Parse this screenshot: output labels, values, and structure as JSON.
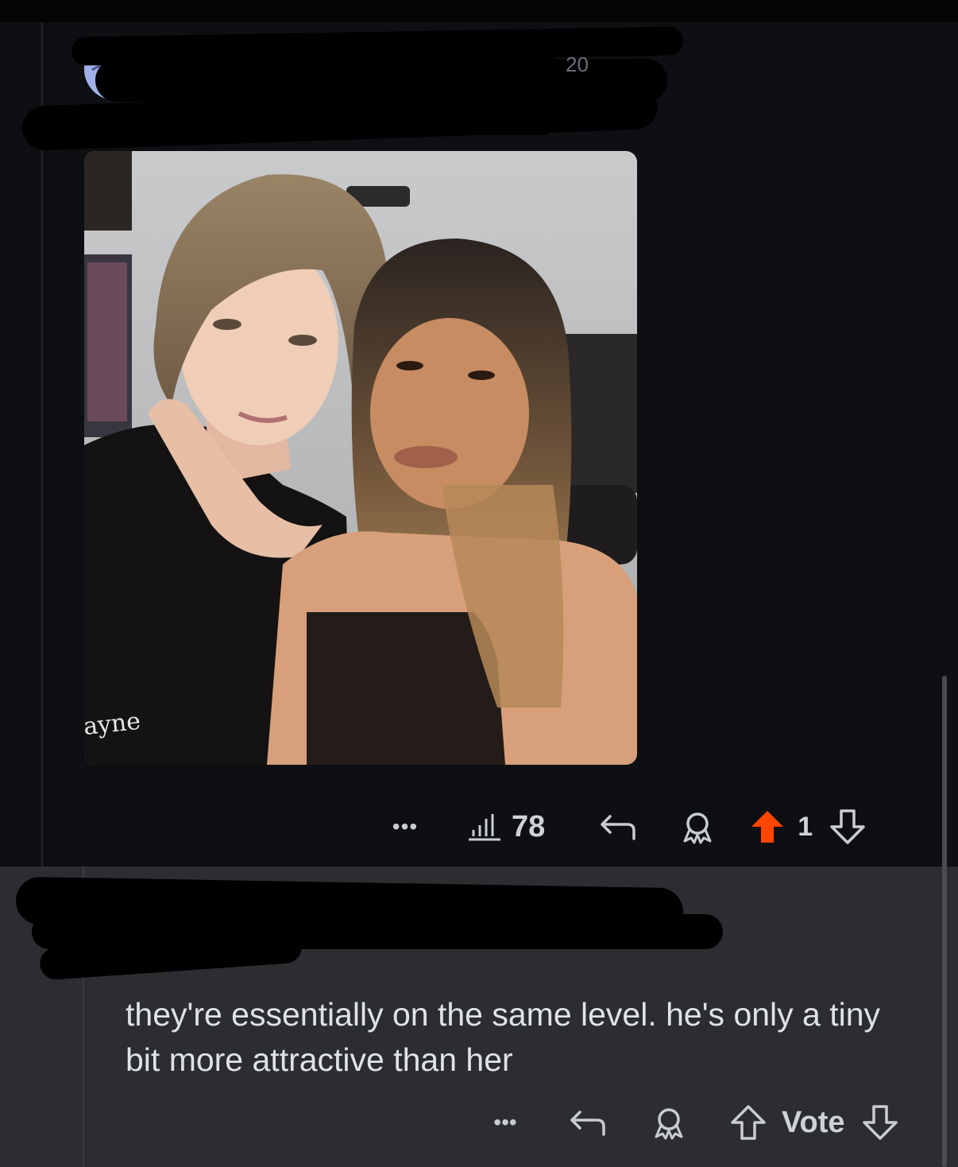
{
  "post": {
    "header_meta": "20",
    "image": {
      "shirt_graffiti": "ayne"
    },
    "actions": {
      "more_label": "•••",
      "views_count": "78",
      "vote_count": "1"
    }
  },
  "comment": {
    "text": "they're essentially on the same level. he's only a tiny bit more attractive than her",
    "actions": {
      "more_label": "•••",
      "vote_label": "Vote"
    }
  },
  "colors": {
    "background": "#0e0f12",
    "comment_background": "#2b2d30",
    "upvote_active": "#ff4500",
    "avatar": "#9fb0e8"
  },
  "icons": [
    "more-icon",
    "views-icon",
    "reply-icon",
    "award-icon",
    "upvote-icon",
    "downvote-icon"
  ]
}
